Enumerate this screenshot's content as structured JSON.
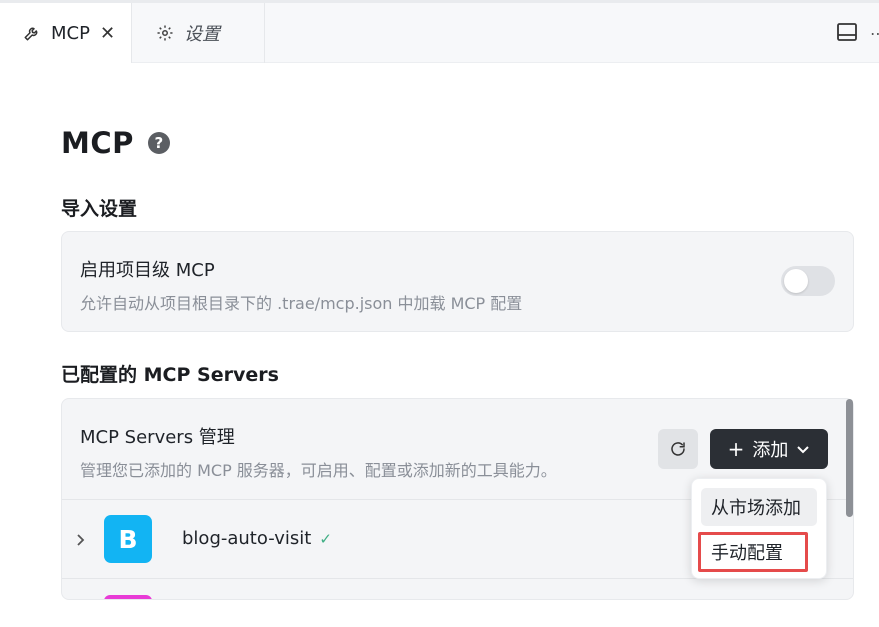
{
  "tabs": [
    {
      "label": "MCP",
      "icon": "wrench-icon",
      "close": "✕"
    },
    {
      "label": "设置",
      "icon": "gear-icon"
    }
  ],
  "page": {
    "title": "MCP",
    "help": "?"
  },
  "import_section": {
    "title": "导入设置",
    "card": {
      "heading": "启用项目级 MCP",
      "description": "允许自动从项目根目录下的 .trae/mcp.json 中加载 MCP 配置",
      "toggle_on": false
    }
  },
  "servers_section": {
    "title": "已配置的 MCP Servers",
    "card": {
      "heading": "MCP Servers 管理",
      "description": "管理您已添加的 MCP 服务器，可启用、配置或添加新的工具能力。",
      "add_label": "添加",
      "add_plus": "+"
    },
    "servers": [
      {
        "logo_letter": "B",
        "name": "blog-auto-visit",
        "status": "✓",
        "logo_color": "#12b4f3"
      }
    ]
  },
  "dropdown": {
    "items": [
      "从市场添加",
      "手动配置"
    ]
  },
  "colors": {
    "accent_dark": "#2b2f35",
    "highlight_border": "#e54b4b",
    "status_green": "#3fae84"
  }
}
